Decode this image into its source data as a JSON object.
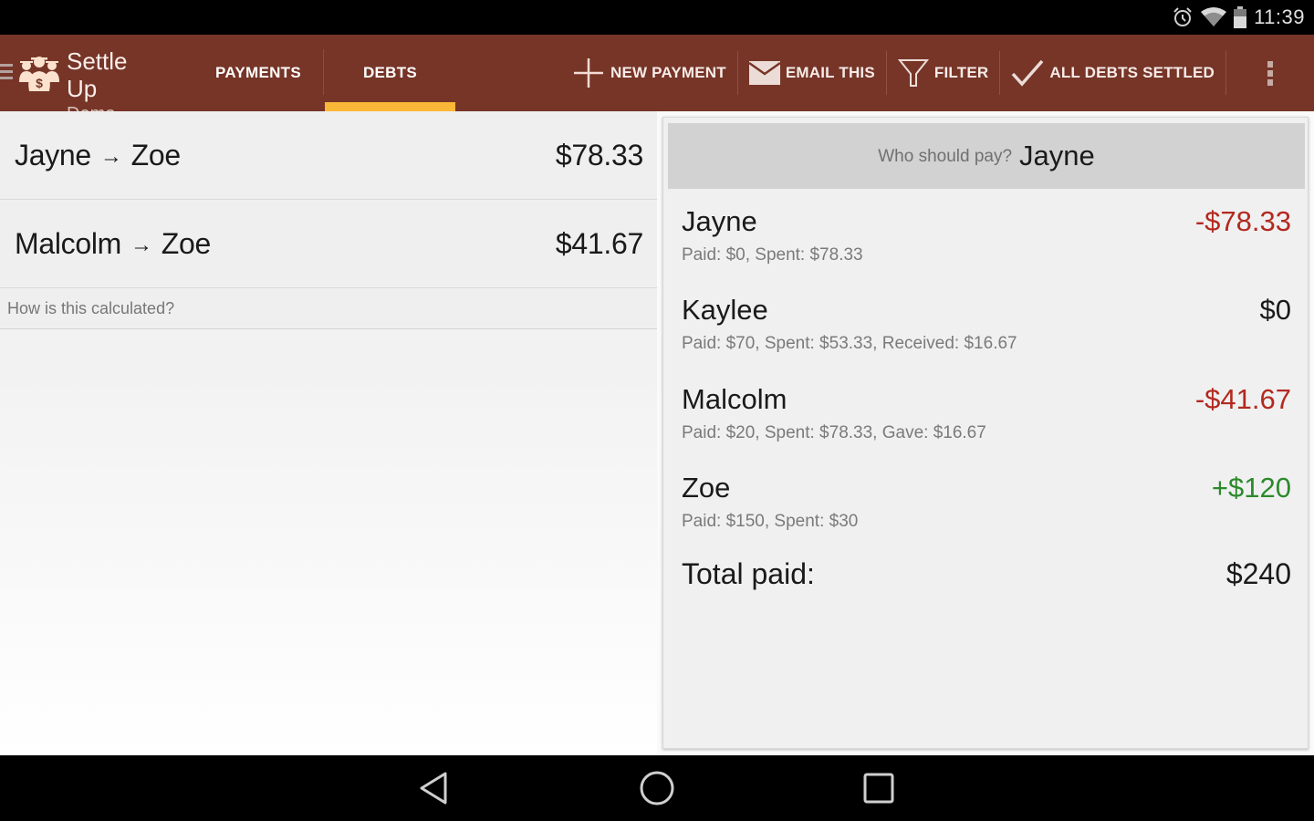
{
  "status_bar": {
    "time": "11:39",
    "icons": [
      "alarm-icon",
      "wifi-icon",
      "battery-icon"
    ]
  },
  "action_bar": {
    "app_title": "Settle Up",
    "group_name": "Demo group",
    "tabs": [
      {
        "label": "PAYMENTS",
        "selected": false
      },
      {
        "label": "DEBTS",
        "selected": true
      }
    ],
    "actions": [
      {
        "label": "NEW PAYMENT",
        "icon": "plus-icon"
      },
      {
        "label": "EMAIL THIS",
        "icon": "envelope-icon"
      },
      {
        "label": "FILTER",
        "icon": "filter-icon"
      },
      {
        "label": "ALL DEBTS SETTLED",
        "icon": "checkmark-icon"
      }
    ],
    "overflow_icon": "more-vert-icon",
    "colors": {
      "bar": "#763527",
      "tab_indicator": "#fbb737"
    }
  },
  "debts": {
    "items": [
      {
        "from": "Jayne",
        "arrow": "→",
        "to": "Zoe",
        "amount": "$78.33"
      },
      {
        "from": "Malcolm",
        "arrow": "→",
        "to": "Zoe",
        "amount": "$41.67"
      }
    ],
    "how_calculated": "How is this calculated?"
  },
  "summary": {
    "who_should_pay_label": "Who should pay?",
    "who_should_pay_name": "Jayne",
    "members": [
      {
        "name": "Jayne",
        "balance": "-$78.33",
        "detail": "Paid: $0, Spent: $78.33",
        "status": "negative"
      },
      {
        "name": "Kaylee",
        "balance": "$0",
        "detail": "Paid: $70, Spent: $53.33, Received: $16.67",
        "status": "zero"
      },
      {
        "name": "Malcolm",
        "balance": "-$41.67",
        "detail": "Paid: $20, Spent: $78.33, Gave: $16.67",
        "status": "negative"
      },
      {
        "name": "Zoe",
        "balance": "+$120",
        "detail": "Paid: $150, Spent: $30",
        "status": "positive"
      }
    ],
    "total_label": "Total paid:",
    "total_value": "$240",
    "colors": {
      "negative": "#b3291f",
      "positive": "#2b8a2b"
    }
  },
  "nav_bar": {
    "buttons": [
      "back-icon",
      "home-icon",
      "recents-icon"
    ]
  }
}
